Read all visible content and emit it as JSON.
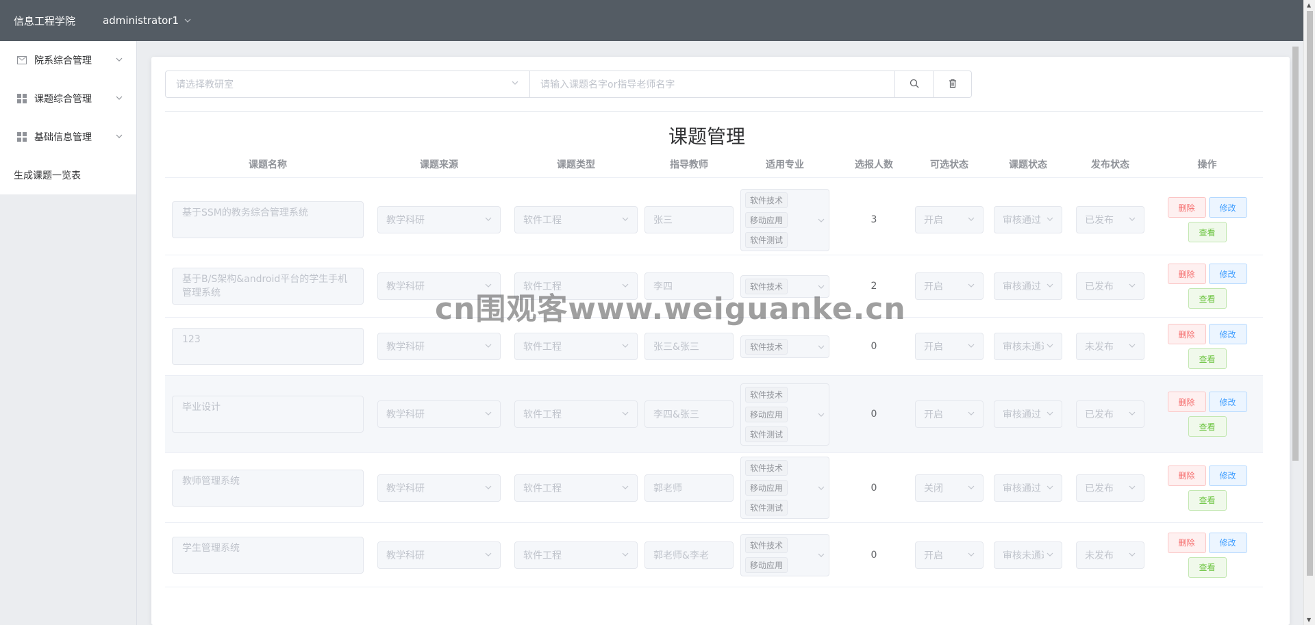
{
  "header": {
    "brand": "信息工程学院",
    "user": "administrator1"
  },
  "sidebar": {
    "items": [
      {
        "label": "院系综合管理",
        "icon": "mail-icon"
      },
      {
        "label": "课题综合管理",
        "icon": "grid-icon"
      },
      {
        "label": "基础信息管理",
        "icon": "grid-icon"
      }
    ],
    "plain_item": "生成课题一览表"
  },
  "filter": {
    "select_placeholder": "请选择教研室",
    "search_placeholder": "请输入课题名字or指导老师名字"
  },
  "page_title": "课题管理",
  "columns": [
    "课题名称",
    "课题来源",
    "课题类型",
    "指导教师",
    "适用专业",
    "选报人数",
    "可选状态",
    "课题状态",
    "发布状态",
    "操作"
  ],
  "actions": {
    "delete": "删除",
    "edit": "修改",
    "view": "查看"
  },
  "rows": [
    {
      "name": "基于SSM的教务综合管理系统",
      "source": "教学科研",
      "type": "软件工程",
      "teacher": "张三",
      "majors": [
        "软件技术",
        "移动应用",
        "软件测试"
      ],
      "count": "3",
      "selectable": "开启",
      "status": "审核通过",
      "publish": "已发布"
    },
    {
      "name": "基于B/S架构&android平台的学生手机管理系统",
      "source": "教学科研",
      "type": "软件工程",
      "teacher": "李四",
      "majors": [
        "软件技术"
      ],
      "count": "2",
      "selectable": "开启",
      "status": "审核通过",
      "publish": "已发布"
    },
    {
      "name": "123",
      "source": "教学科研",
      "type": "软件工程",
      "teacher": "张三&张三",
      "majors": [
        "软件技术"
      ],
      "count": "0",
      "selectable": "开启",
      "status": "审核未通过",
      "publish": "未发布"
    },
    {
      "name": "毕业设计",
      "source": "教学科研",
      "type": "软件工程",
      "teacher": "李四&张三",
      "majors": [
        "软件技术",
        "移动应用",
        "软件测试"
      ],
      "count": "0",
      "selectable": "开启",
      "status": "审核通过",
      "publish": "已发布"
    },
    {
      "name": "教师管理系统",
      "source": "教学科研",
      "type": "软件工程",
      "teacher": "郭老师",
      "majors": [
        "软件技术",
        "移动应用",
        "软件测试"
      ],
      "count": "0",
      "selectable": "关闭",
      "status": "审核通过",
      "publish": "已发布"
    },
    {
      "name": "学生管理系统",
      "source": "教学科研",
      "type": "软件工程",
      "teacher": "郭老师&李老",
      "majors": [
        "软件技术",
        "移动应用"
      ],
      "count": "0",
      "selectable": "开启",
      "status": "审核未通过",
      "publish": "未发布"
    }
  ],
  "watermark": "cn围观客www.weiguanke.cn"
}
